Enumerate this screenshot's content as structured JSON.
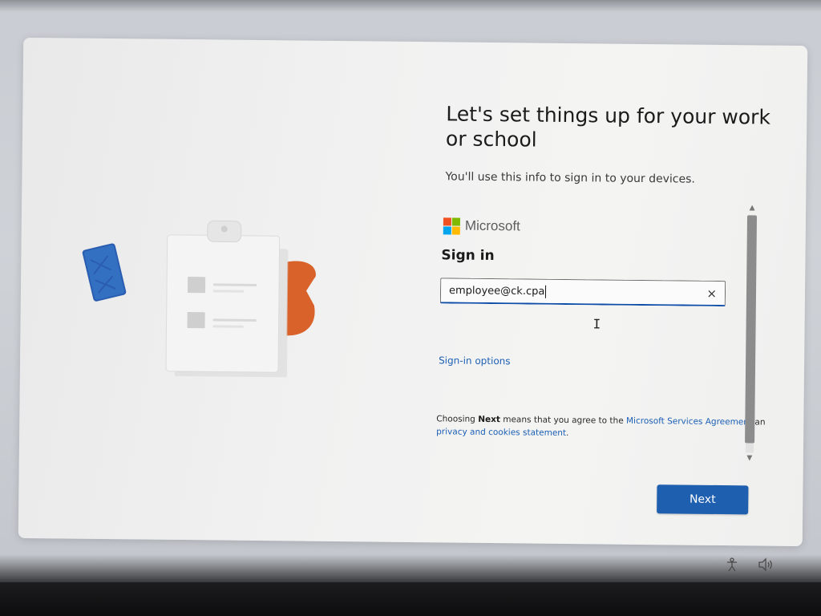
{
  "page": {
    "title": "Let's set things up for your work or school",
    "subtitle": "You'll use this info to sign in to your devices."
  },
  "brand": {
    "name": "Microsoft",
    "logo_colors": [
      "#f25022",
      "#7fba00",
      "#00a4ef",
      "#ffb900"
    ]
  },
  "signin": {
    "heading": "Sign in",
    "email_value": "employee@ck.cpa",
    "clear_icon": "×",
    "options_link": "Sign-in options"
  },
  "legal": {
    "prefix": "Choosing ",
    "bold": "Next",
    "middle": " means that you agree to the ",
    "agreement_link": "Microsoft Services Agreement",
    "and": " an",
    "privacy_link": "privacy and cookies statement",
    "suffix": "."
  },
  "buttons": {
    "next_label": "Next"
  },
  "tray": {
    "accessibility_icon": "accessibility-icon",
    "volume_icon": "volume-icon"
  },
  "colors": {
    "accent": "#1f5fb0",
    "link": "#1c5fb4",
    "illustration_blue": "#2a5db0",
    "illustration_orange": "#d9622b"
  }
}
